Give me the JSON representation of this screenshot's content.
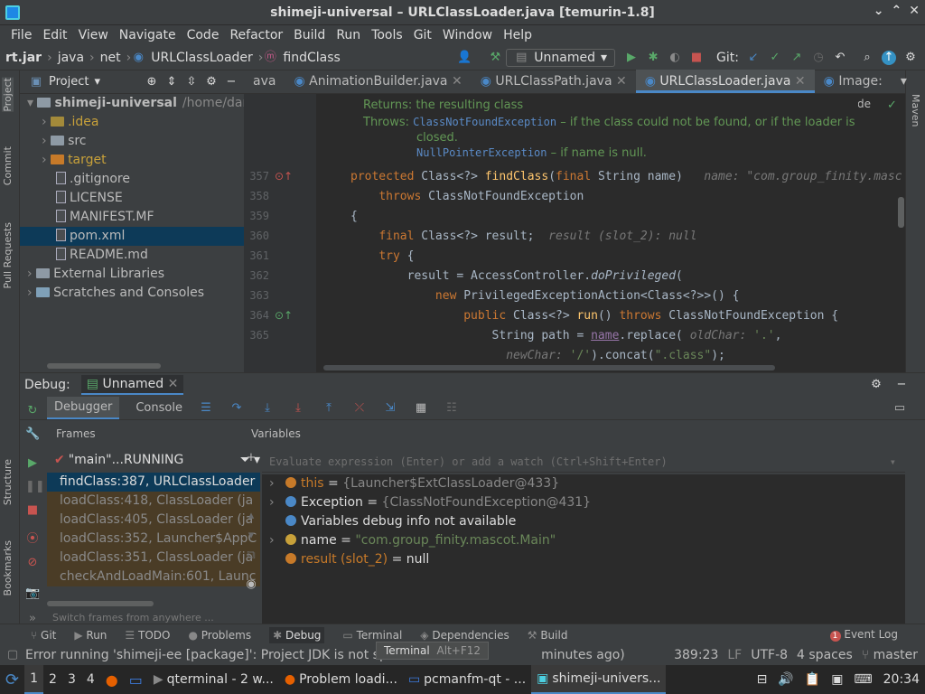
{
  "window": {
    "title": "shimeji-universal – URLClassLoader.java [temurin-1.8]",
    "controls": [
      "⌄",
      "⌃",
      "✕"
    ]
  },
  "menu": [
    "File",
    "Edit",
    "View",
    "Navigate",
    "Code",
    "Refactor",
    "Build",
    "Run",
    "Tools",
    "Git",
    "Window",
    "Help"
  ],
  "nav": {
    "crumbs": [
      "rt.jar",
      "java",
      "net",
      "URLClassLoader",
      "findClass"
    ],
    "run_config": "Unnamed",
    "git_label": "Git:"
  },
  "project": {
    "header": "Project",
    "items": [
      {
        "label": "shimeji-universal",
        "extra": "/home/dartz",
        "indent": 0,
        "type": "module"
      },
      {
        "label": ".idea",
        "indent": 1,
        "type": "folder-y"
      },
      {
        "label": "src",
        "indent": 1,
        "type": "folder"
      },
      {
        "label": "target",
        "indent": 1,
        "type": "folder-o"
      },
      {
        "label": ".gitignore",
        "indent": 2,
        "type": "file"
      },
      {
        "label": "LICENSE",
        "indent": 2,
        "type": "file"
      },
      {
        "label": "MANIFEST.MF",
        "indent": 2,
        "type": "file"
      },
      {
        "label": "pom.xml",
        "indent": 2,
        "type": "file",
        "selected": true
      },
      {
        "label": "README.md",
        "indent": 2,
        "type": "file"
      },
      {
        "label": "External Libraries",
        "indent": 0,
        "type": "lib"
      },
      {
        "label": "Scratches and Consoles",
        "indent": 0,
        "type": "scratch"
      }
    ]
  },
  "editor": {
    "tabs": [
      "ava",
      "AnimationBuilder.java",
      "URLClassPath.java",
      "URLClassLoader.java",
      "Image:"
    ],
    "active_tab": 3,
    "reader_mode": "Reader Mode",
    "doc": {
      "returns": "Returns: the resulting class",
      "throws_label": "Throws:",
      "ex1": "ClassNotFoundException",
      "ex1_desc": " – if the class could not be found, or if the loader is",
      "ex1_desc2": "closed.",
      "ex2": "NullPointerException",
      "ex2_desc": " – if name is null."
    },
    "line_numbers": [
      "357",
      "358",
      "359",
      "360",
      "361",
      "362",
      "363",
      "364",
      "365"
    ],
    "hints": {
      "name": "name: \"com.group_finity.masc",
      "result": "result (slot_2): null",
      "oldchar": "oldChar:",
      "newchar": "newChar:"
    }
  },
  "debug": {
    "label": "Debug:",
    "session": "Unnamed",
    "tabs": [
      "Debugger",
      "Console"
    ],
    "frames_label": "Frames",
    "variables_label": "Variables",
    "thread": "\"main\"...RUNNING",
    "frames": [
      "findClass:387, URLClassLoader",
      "loadClass:418, ClassLoader (ja",
      "loadClass:405, ClassLoader (ja",
      "loadClass:352, Launcher$AppC",
      "loadClass:351, ClassLoader (ja",
      "checkAndLoadMain:601, Launc"
    ],
    "switch_hint": "Switch frames from anywhere ...",
    "eval_placeholder": "Evaluate expression (Enter) or add a watch (Ctrl+Shift+Enter)",
    "vars": [
      {
        "name": "this",
        "value": "{Launcher$ExtClassLoader@433}",
        "expandable": true,
        "color": "#c77a29"
      },
      {
        "name": "Exception",
        "value": "{ClassNotFoundException@431}",
        "expandable": true,
        "color": "#4a88c7"
      },
      {
        "name": "Variables debug info not available",
        "value": "",
        "expandable": false,
        "color": "#4a88c7"
      },
      {
        "name": "name",
        "value": "\"com.group_finity.mascot.Main\"",
        "expandable": true,
        "color": "#c8a13a"
      },
      {
        "name": "result (slot_2)",
        "value": "null",
        "expandable": false,
        "color": "#c77a29"
      }
    ]
  },
  "bottom_tabs": [
    "Git",
    "Run",
    "TODO",
    "Problems",
    "Debug",
    "Terminal",
    "Dependencies",
    "Build"
  ],
  "event_log": "Event Log",
  "tooltip": {
    "label": "Terminal",
    "shortcut": "Alt+F12"
  },
  "status": {
    "message": "Error running 'shimeji-ee [package]': Project JDK is not spec",
    "message_tail": "minutes ago)",
    "position": "389:23",
    "lf": "LF",
    "encoding": "UTF-8",
    "indent": "4 spaces",
    "branch": "master"
  },
  "taskbar": {
    "workspaces": [
      "1",
      "2",
      "3",
      "4"
    ],
    "tasks": [
      "qterminal - 2 w...",
      "Problem loadi...",
      "pcmanfm-qt - ...",
      "shimeji-univers..."
    ],
    "time": "20:34"
  },
  "side": {
    "left": [
      "Project",
      "Commit",
      "Pull Requests",
      "Structure",
      "Bookmarks"
    ],
    "right": "Maven"
  }
}
